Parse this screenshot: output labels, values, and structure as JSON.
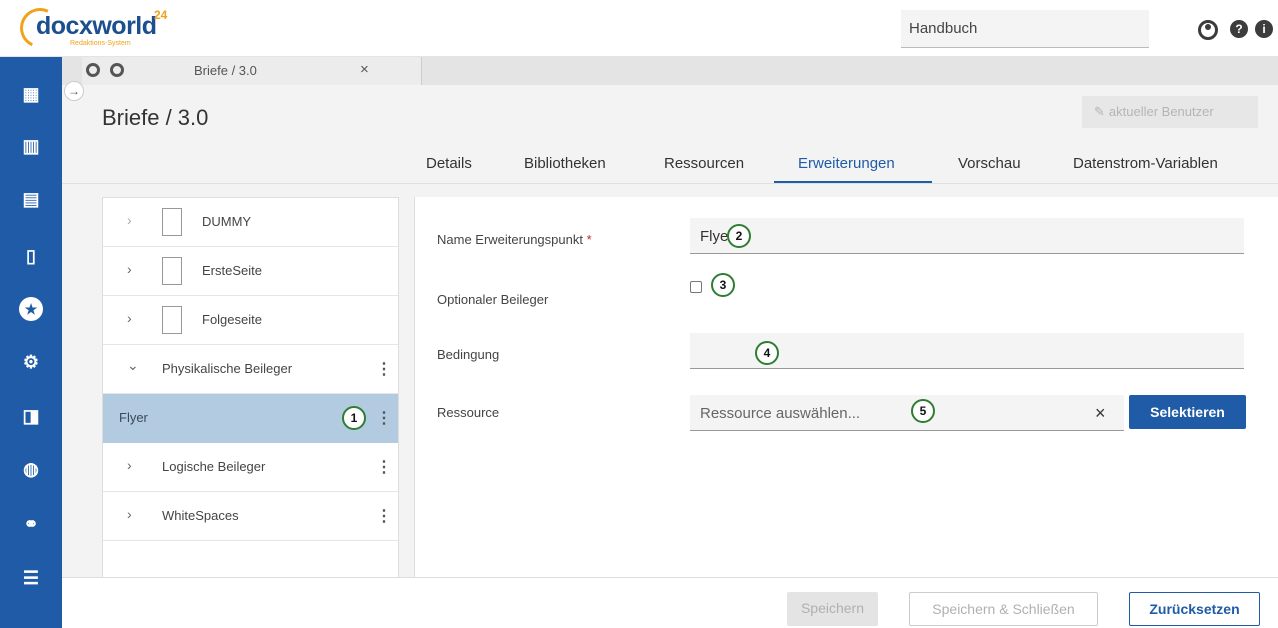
{
  "header": {
    "logo_text_a": "doc",
    "logo_text_b": "xworld",
    "logo_sup": "24",
    "logo_sub": "Redaktions-System",
    "search_value": "Handbuch",
    "icons": [
      "user-circle-icon",
      "help-icon",
      "info-icon"
    ]
  },
  "nav": {
    "items": [
      {
        "icon": "dashboard-icon",
        "glyph": "▦"
      },
      {
        "icon": "building-icon",
        "glyph": "▥"
      },
      {
        "icon": "document-icon",
        "glyph": "▤"
      },
      {
        "icon": "book-icon",
        "glyph": "▯"
      },
      {
        "icon": "star-icon",
        "glyph": "★"
      },
      {
        "icon": "cogs-icon",
        "glyph": "⚙"
      },
      {
        "icon": "file-icon",
        "glyph": "◨"
      },
      {
        "icon": "globe-icon",
        "glyph": "◍"
      },
      {
        "icon": "link-icon",
        "glyph": "⚭"
      },
      {
        "icon": "users-icon",
        "glyph": "☰"
      }
    ]
  },
  "tabbar": {
    "open_tab_label": "Briefe / 3.0",
    "close_glyph": "×"
  },
  "page": {
    "title": "Briefe / 3.0",
    "user_button": "aktueller Benutzer",
    "tabs": [
      "Details",
      "Bibliotheken",
      "Ressourcen",
      "Erweiterungen",
      "Vorschau",
      "Datenstrom-Variablen"
    ],
    "active_tab": "Erweiterungen"
  },
  "tree": {
    "items": [
      {
        "label": "DUMMY",
        "chev": "›"
      },
      {
        "label": "ErsteSeite",
        "chev": "›"
      },
      {
        "label": "Folgeseite",
        "chev": "›"
      },
      {
        "label": "Physikalische Beileger",
        "chev": "⌄",
        "menu": "⋮"
      },
      {
        "label": "Flyer",
        "menu": "⋮"
      },
      {
        "label": "Logische Beileger",
        "chev": "›",
        "menu": "⋮"
      },
      {
        "label": "WhiteSpaces",
        "chev": "›",
        "menu": "⋮"
      }
    ]
  },
  "form": {
    "name_label": "Name Erweiterungspunkt",
    "required_mark": "*",
    "name_value": "Flyer",
    "optional_label": "Optionaler Beileger",
    "optional_checked": false,
    "condition_label": "Bedingung",
    "condition_value": "",
    "resource_label": "Ressource",
    "resource_placeholder": "Ressource auswählen...",
    "clear_glyph": "×",
    "select_button": "Selektieren"
  },
  "badges": [
    "1",
    "2",
    "3",
    "4",
    "5"
  ],
  "footer": {
    "save": "Speichern",
    "save_close": "Speichern & Schließen",
    "reset": "Zurücksetzen"
  },
  "colors": {
    "nav_blue": "#1f5ba6",
    "accent_orange": "#f0a21b",
    "selected_row": "#b3cbe0",
    "badge_green": "#2e7d32"
  }
}
